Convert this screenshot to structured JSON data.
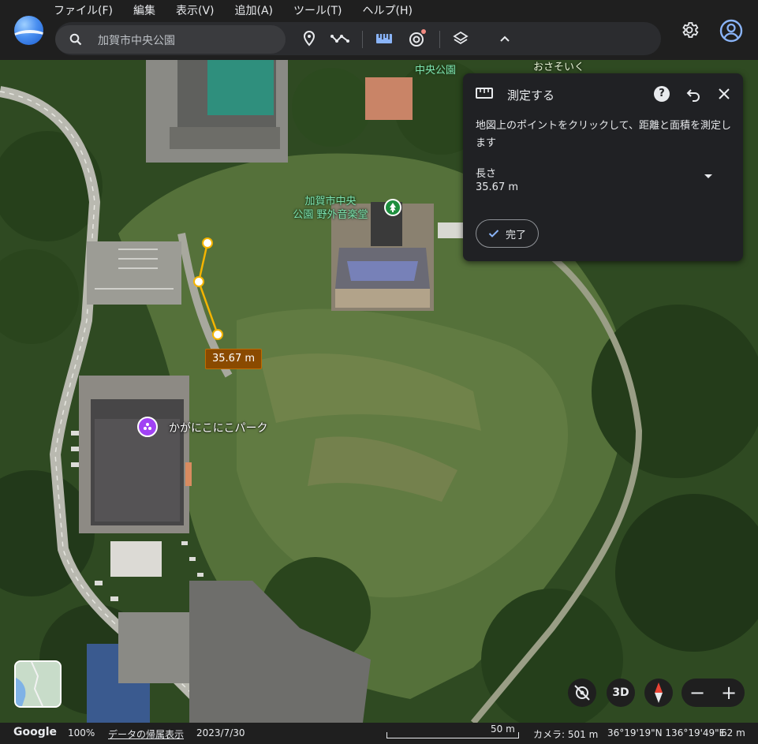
{
  "menu": [
    "ファイル(F)",
    "編集",
    "表示(V)",
    "追加(A)",
    "ツール(T)",
    "ヘルプ(H)"
  ],
  "search": {
    "value": "加賀市中央公園",
    "placeholder": ""
  },
  "icons": {
    "search": "search-icon",
    "pin": "add-placemark-icon",
    "path": "add-path-icon",
    "ruler": "ruler-icon",
    "voyager": "voyager-icon",
    "layers": "layers-icon",
    "collapse": "chevron-up-icon",
    "settings": "gear-icon",
    "account": "account-icon"
  },
  "map": {
    "labels": {
      "park_top": "中央公園",
      "top_right": "おさそいく",
      "park_stage": "加賀市中央\n公園 野外音楽堂",
      "kaga_park": "かがにこにこパーク"
    },
    "measurement_tag": "35.67 m"
  },
  "measure_panel": {
    "title": "測定する",
    "help": "?",
    "description": "地図上のポイントをクリックして、距離と面積を測定します",
    "length_label": "長さ",
    "length_value": "35.67 m",
    "done_label": "完了"
  },
  "controls": {
    "three_d": "3D",
    "zoom_out": "−",
    "zoom_in": "+"
  },
  "status": {
    "google": "Google",
    "zoom": "100%",
    "attribution": "データの帰属表示",
    "date": "2023/7/30",
    "scale": "50 m",
    "camera": "カメラ: 501 m",
    "coords": "36°19'19\"N 136°19'49\"E",
    "elevation": "62 m"
  },
  "colors": {
    "accent": "#8ab4f8",
    "measure_line": "#f4b400",
    "dist_tag_bg": "#8a4a00",
    "park_pin": "#1e8e3e",
    "poi_pin": "#a142f4"
  }
}
